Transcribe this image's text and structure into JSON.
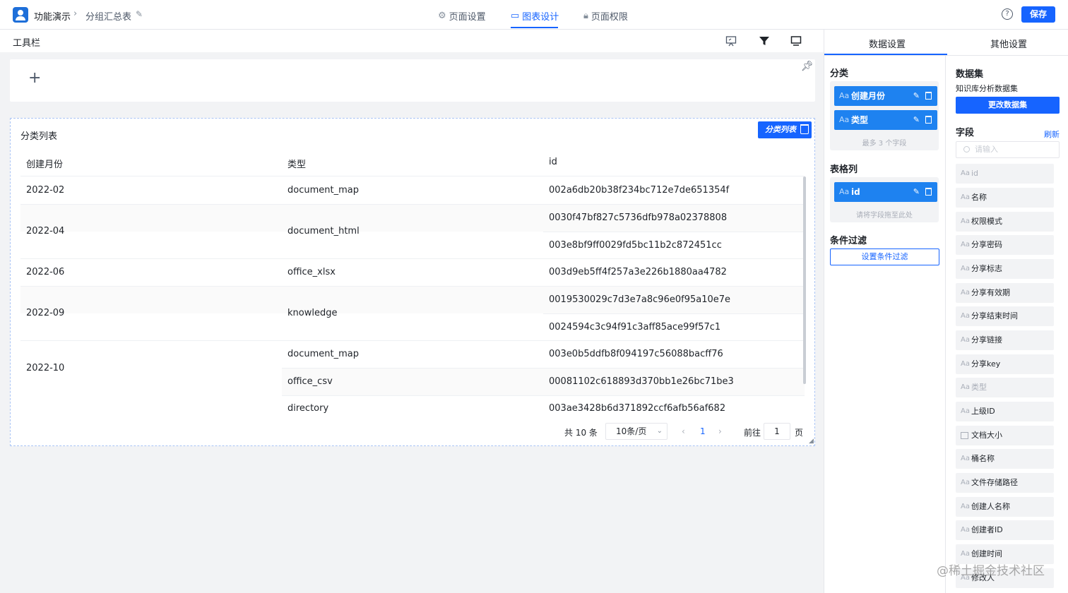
{
  "topbar": {
    "app": "功能演示",
    "page": "分组汇总表",
    "tabs": [
      "页面设置",
      "图表设计",
      "页面权限"
    ],
    "active_tab": "图表设计",
    "help": "?",
    "save": "保存"
  },
  "toolbar": {
    "title": "工具栏"
  },
  "canvas": {
    "plus": "+"
  },
  "table_card": {
    "title": "分类列表",
    "tag": "分类列表",
    "headers": [
      "创建月份",
      "类型",
      "id"
    ],
    "rows": [
      {
        "month": "2022-02",
        "type": "document_map",
        "ids": [
          "002a6db20b38f234bc712e7de651354f"
        ]
      },
      {
        "month": "2022-04",
        "type": "document_html",
        "ids": [
          "0030f47bf827c5736dfb978a02378808",
          "003e8bf9ff0029fd5bc11b2c872451cc"
        ]
      },
      {
        "month": "2022-06",
        "type": "office_xlsx",
        "ids": [
          "003d9eb5ff4f257a3e226b1880aa4782"
        ]
      },
      {
        "month": "2022-09",
        "type": "knowledge",
        "ids": [
          "0019530029c7d3e7a8c96e0f95a10e7e",
          "0024594c3c94f91c3aff85ace99f57c1"
        ]
      },
      {
        "month": "2022-10",
        "types": [
          "document_map",
          "office_csv",
          "directory"
        ],
        "ids": [
          "003e0b5ddfb8f094197c56088bacff76",
          "00081102c618893d370bb1e26bc71be3",
          "003ae3428b6d371892ccf6afb56af682"
        ]
      }
    ],
    "pager": {
      "total": "共 10 条",
      "page_size": "10条/页",
      "current": "1",
      "goto_label": "前往",
      "goto_value": "1",
      "page_suffix": "页"
    }
  },
  "panel": {
    "tabs": [
      "数据设置",
      "其他设置"
    ],
    "category": {
      "title": "分类",
      "fields": [
        "创建月份",
        "类型"
      ],
      "hint": "最多 3 个字段"
    },
    "columns": {
      "title": "表格列",
      "fields": [
        "id"
      ],
      "hint": "请将字段拖至此处"
    },
    "filter": {
      "title": "条件过滤",
      "button": "设置条件过滤"
    },
    "dataset": {
      "title": "数据集",
      "name": "知识库分析数据集",
      "change": "更改数据集"
    },
    "fields": {
      "title": "字段",
      "refresh": "刷新",
      "placeholder": "请输入",
      "items": [
        "id",
        "名称",
        "权限模式",
        "分享密码",
        "分享标志",
        "分享有效期",
        "分享结束时间",
        "分享链接",
        "分享key",
        "类型",
        "上级ID",
        "文档大小",
        "桶名称",
        "文件存储路径",
        "创建人名称",
        "创建者ID",
        "创建时间",
        "修改人"
      ]
    }
  },
  "watermark": "@稀土掘金技术社区",
  "colors": {
    "primary": "#1664ff",
    "pill": "#1e82f0"
  }
}
